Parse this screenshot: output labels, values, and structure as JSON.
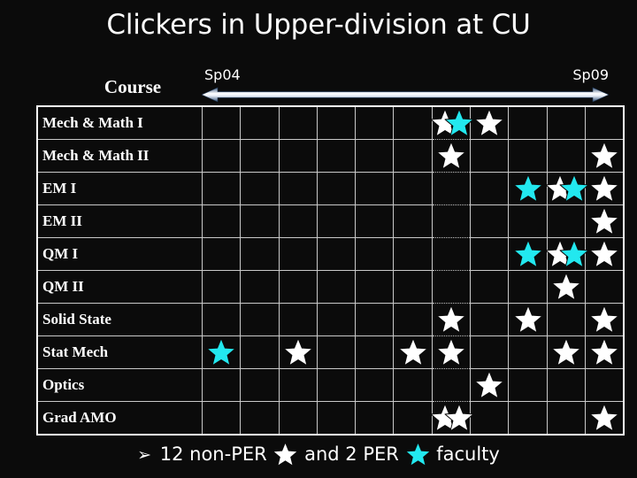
{
  "slide": {
    "background_color": "#0b0b0b",
    "title": "Clickers in Upper-division at CU"
  },
  "header": {
    "course_label": "Course",
    "timeline_start": "Sp04",
    "timeline_end": "Sp09",
    "arrow_icon": "double-headed-arrow"
  },
  "colors": {
    "non_per_star": "#ffffff",
    "per_star": "#22e8ef",
    "grid_line": "#c9c9c9",
    "frame": "#ffffff",
    "text": "#ffffff"
  },
  "table": {
    "column_count": 11,
    "dotted_column_index": 7,
    "rows": [
      {
        "label": "Mech & Math I",
        "stars": [
          {
            "column": 7,
            "color": "non-per",
            "offset": "shift-left"
          },
          {
            "column": 7,
            "color": "per",
            "offset": "shift-right"
          },
          {
            "column": 8,
            "color": "non-per",
            "offset": "center"
          }
        ]
      },
      {
        "label": "Mech & Math II",
        "stars": [
          {
            "column": 7,
            "color": "non-per",
            "offset": "center"
          },
          {
            "column": 11,
            "color": "non-per",
            "offset": "center"
          }
        ]
      },
      {
        "label": "EM I",
        "stars": [
          {
            "column": 9,
            "color": "per",
            "offset": "center"
          },
          {
            "column": 10,
            "color": "non-per",
            "offset": "shift-left"
          },
          {
            "column": 10,
            "color": "per",
            "offset": "shift-right"
          },
          {
            "column": 11,
            "color": "non-per",
            "offset": "center"
          }
        ]
      },
      {
        "label": "EM II",
        "stars": [
          {
            "column": 11,
            "color": "non-per",
            "offset": "center"
          }
        ]
      },
      {
        "label": "QM I",
        "stars": [
          {
            "column": 9,
            "color": "per",
            "offset": "center"
          },
          {
            "column": 10,
            "color": "non-per",
            "offset": "shift-left"
          },
          {
            "column": 10,
            "color": "per",
            "offset": "shift-right"
          },
          {
            "column": 11,
            "color": "non-per",
            "offset": "center"
          }
        ]
      },
      {
        "label": "QM II",
        "stars": [
          {
            "column": 10,
            "color": "non-per",
            "offset": "center"
          }
        ]
      },
      {
        "label": "Solid State",
        "stars": [
          {
            "column": 7,
            "color": "non-per",
            "offset": "center"
          },
          {
            "column": 9,
            "color": "non-per",
            "offset": "center"
          },
          {
            "column": 11,
            "color": "non-per",
            "offset": "center"
          }
        ]
      },
      {
        "label": "Stat Mech",
        "stars": [
          {
            "column": 1,
            "color": "per",
            "offset": "center"
          },
          {
            "column": 3,
            "color": "non-per",
            "offset": "center"
          },
          {
            "column": 6,
            "color": "non-per",
            "offset": "center"
          },
          {
            "column": 7,
            "color": "non-per",
            "offset": "center"
          },
          {
            "column": 10,
            "color": "non-per",
            "offset": "center"
          },
          {
            "column": 11,
            "color": "non-per",
            "offset": "center"
          }
        ]
      },
      {
        "label": "Optics",
        "stars": [
          {
            "column": 8,
            "color": "non-per",
            "offset": "center"
          }
        ]
      },
      {
        "label": "Grad AMO",
        "stars": [
          {
            "column": 7,
            "color": "non-per",
            "offset": "shift-left"
          },
          {
            "column": 7,
            "color": "non-per",
            "offset": "shift-right"
          },
          {
            "column": 11,
            "color": "non-per",
            "offset": "center"
          }
        ]
      }
    ]
  },
  "footer": {
    "bullet": "➢",
    "text_before": "12 non-PER",
    "text_middle": "and 2 PER",
    "text_after": "faculty",
    "non_per_star_icon": "white-star-icon",
    "per_star_icon": "cyan-star-icon"
  }
}
